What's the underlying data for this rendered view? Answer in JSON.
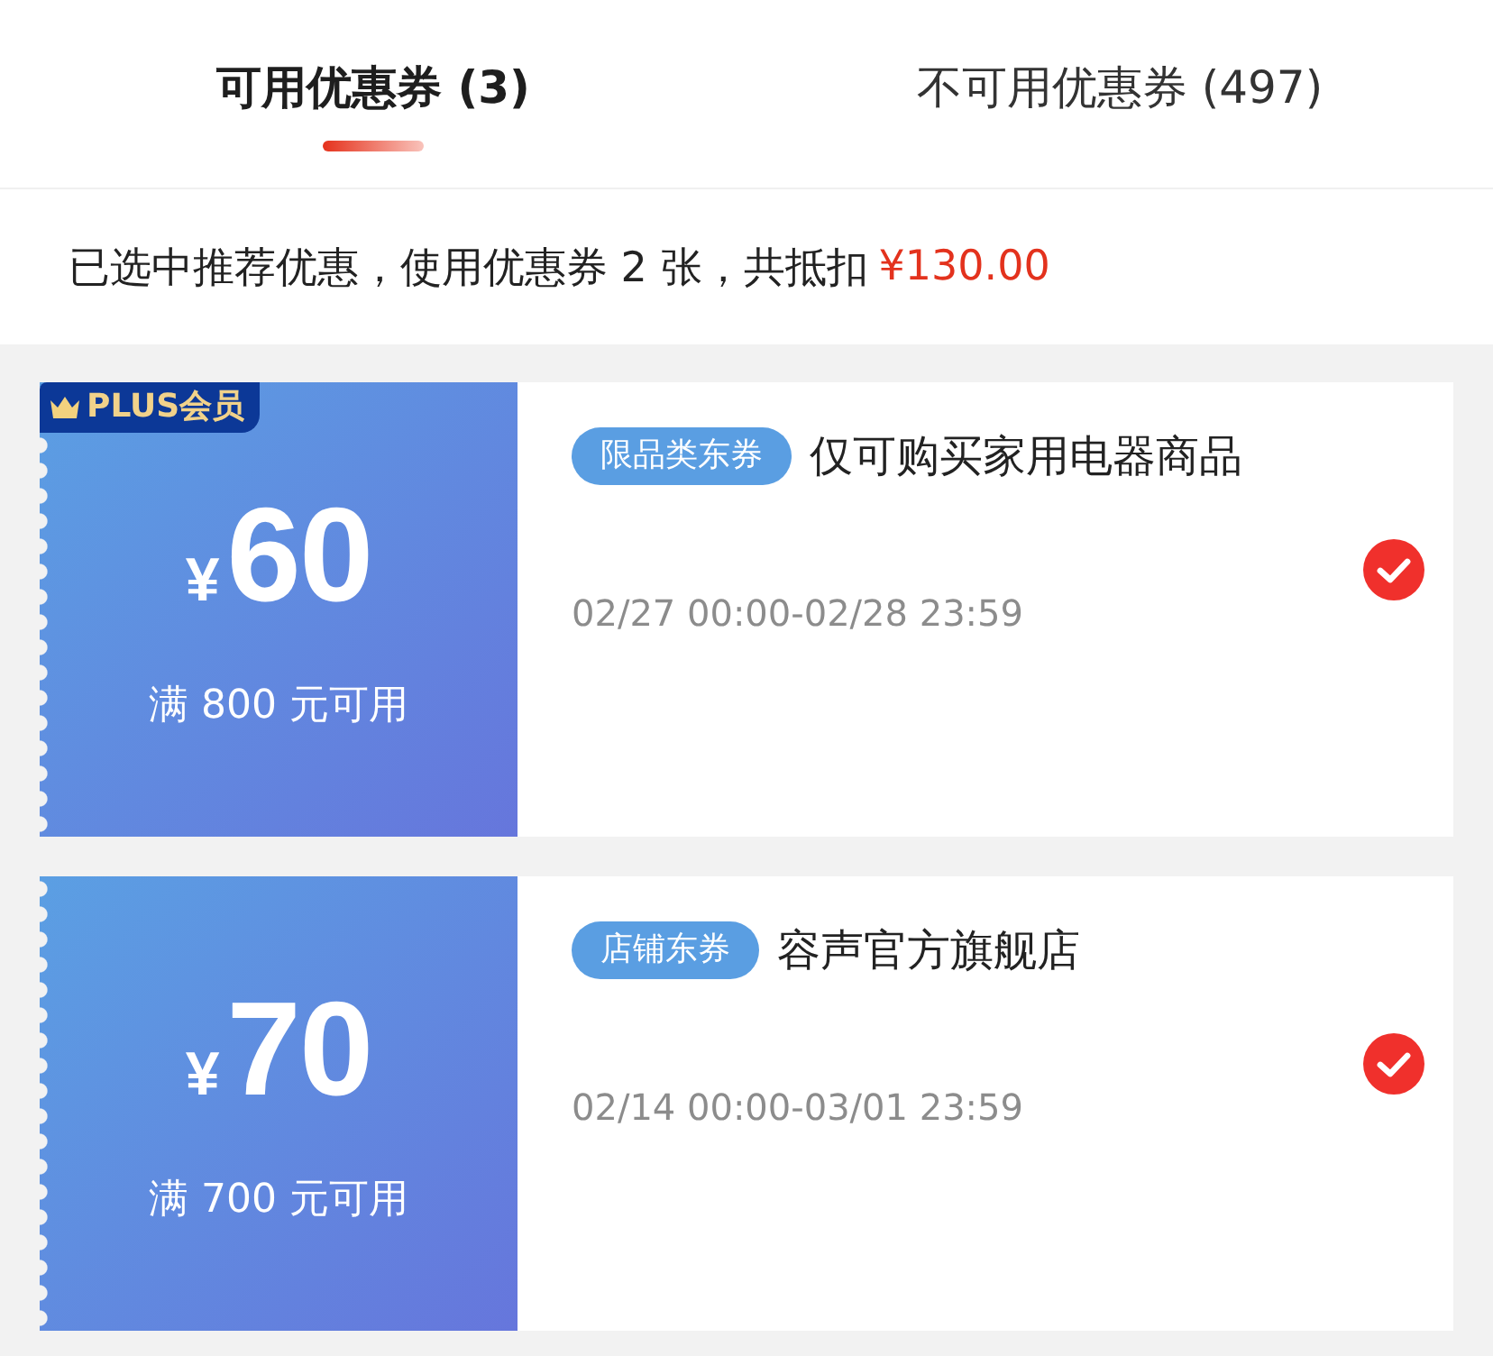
{
  "tabs": [
    {
      "label": "可用优惠券 (3)",
      "selected": true
    },
    {
      "label": "不可用优惠券 (497)",
      "selected": false
    }
  ],
  "summary": {
    "text": "已选中推荐优惠，使用优惠券 2 张，共抵扣",
    "amount": "¥130.00"
  },
  "coupons": [
    {
      "badge": "PLUS会员",
      "currency": "¥",
      "amount": "60",
      "condition": "满 800 元可用",
      "tag": "限品类东券",
      "title": "仅可购买家用电器商品",
      "validity": "02/27 00:00-02/28 23:59",
      "selected": true
    },
    {
      "currency": "¥",
      "amount": "70",
      "condition": "满 700 元可用",
      "tag": "店铺东券",
      "title": "容声官方旗舰店",
      "validity": "02/14 00:00-03/01 23:59",
      "selected": true
    }
  ]
}
